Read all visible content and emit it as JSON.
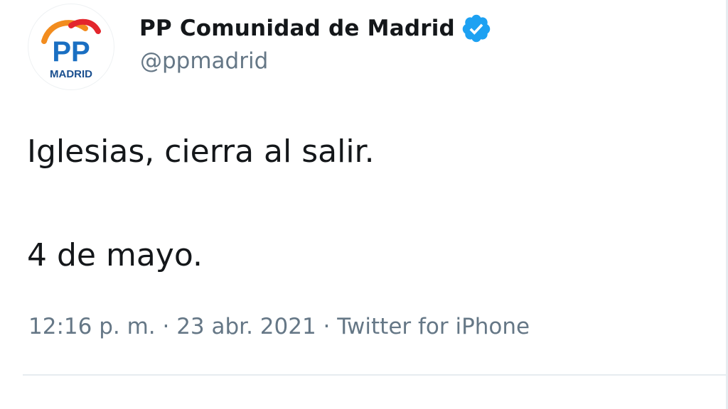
{
  "tweet": {
    "author": {
      "display_name": "PP Comunidad de Madrid",
      "handle": "@ppmadrid",
      "verified": true,
      "verified_icon": "verified-badge-icon",
      "avatar": {
        "logo_text": "PP",
        "logo_subtext": "MADRID",
        "colors": {
          "logo_blue": "#1a6fc2",
          "arc_red": "#e3262d",
          "arc_orange": "#f28c1e",
          "text_blue": "#1a4f8f"
        }
      }
    },
    "text_lines": [
      "Iglesias, cierra al salir.",
      "4 de mayo."
    ],
    "meta": {
      "time": "12:16 p. m.",
      "separator": " · ",
      "date": "23 abr. 2021",
      "source": "Twitter for iPhone"
    }
  },
  "colors": {
    "text_primary": "#14171a",
    "text_secondary": "#657786",
    "verified_blue": "#1da1f2",
    "divider": "#e6ecf0",
    "background": "#ffffff"
  }
}
